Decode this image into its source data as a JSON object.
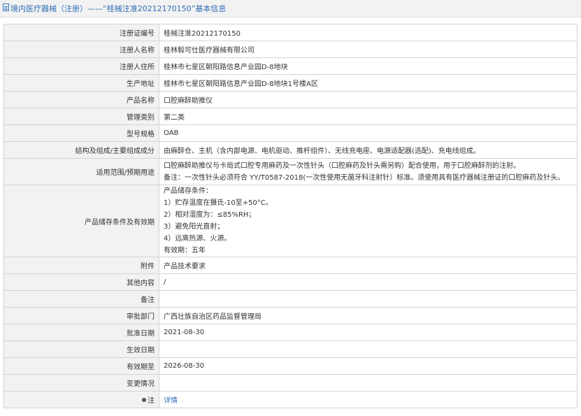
{
  "header": {
    "title": "境内医疗器械（注册）——“桂械注准20212170150”基本信息"
  },
  "rows": [
    {
      "label": "注册证编号",
      "value": "桂械注准20212170150"
    },
    {
      "label": "注册人名称",
      "value": "桂林毅可仕医疗器械有限公司"
    },
    {
      "label": "注册人住所",
      "value": "桂林市七星区朝阳路信息产业园D-8地块"
    },
    {
      "label": "生产地址",
      "value": "桂林市七星区朝阳路信息产业园D-8地块1号楼A区"
    },
    {
      "label": "产品名称",
      "value": "口腔麻醉助推仪"
    },
    {
      "label": "管理类别",
      "value": "第二类"
    },
    {
      "label": "型号规格",
      "value": "OAB"
    },
    {
      "label": "结构及组成/主要组成成分",
      "value": "由麻醉仓、主机（含内部电源、电机驱动、推杆组件）、无线充电座、电源适配器(选配)、充电线组成。"
    },
    {
      "label": "适用范围/预期用途",
      "lines": [
        "口腔麻醉助推仪与卡局式口腔专用麻药及一次性针头（口腔麻药及针头需另购）配合使用，用于口腔麻醉剂的注射。",
        "备注：一次性针头必须符合 YY/T0587-2018(一次性使用无菌牙科注射针）标准。须使用具有医疗器械注册证的口腔麻药及针头。"
      ]
    },
    {
      "label": "产品储存条件及有效期",
      "lines": [
        "产品储存条件：",
        "1）贮存温度在摄氏-10至+50°C。",
        "2）相对湿度为：≤85%RH；",
        "3）避免阳光直射；",
        "4）远离热源、火源。",
        "有效期：五年"
      ]
    },
    {
      "label": "附件",
      "value": "产品技术要求"
    },
    {
      "label": "其他内容",
      "value": "/"
    },
    {
      "label": "备注",
      "value": ""
    },
    {
      "label": "审批部门",
      "value": "广西壮族自治区药品监督管理局"
    },
    {
      "label": "批准日期",
      "value": "2021-08-30"
    },
    {
      "label": "生效日期",
      "value": ""
    },
    {
      "label": "有效期至",
      "value": "2026-08-30"
    },
    {
      "label": "变更情况",
      "value": ""
    },
    {
      "label": "注",
      "value": "详情",
      "icon": "pin-icon"
    }
  ]
}
